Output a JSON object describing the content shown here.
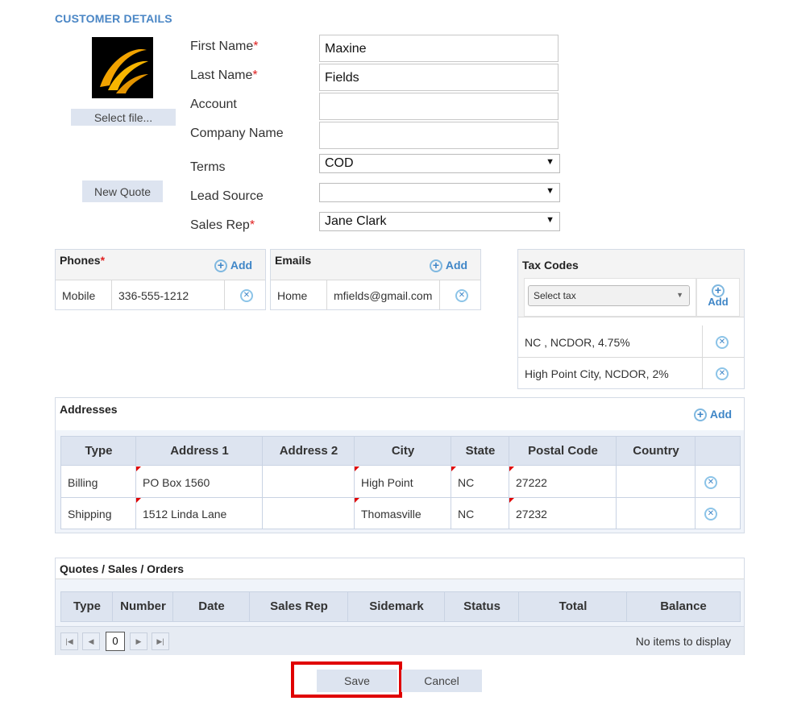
{
  "header": {
    "title": "CUSTOMER DETAILS"
  },
  "photo": {
    "select_file_label": "Select file..."
  },
  "new_quote_label": "New Quote",
  "form": {
    "first_name": {
      "label": "First Name",
      "value": "Maxine"
    },
    "last_name": {
      "label": "Last Name",
      "value": "Fields"
    },
    "account": {
      "label": "Account",
      "value": ""
    },
    "company_name": {
      "label": "Company Name",
      "value": ""
    },
    "terms": {
      "label": "Terms",
      "value": "COD"
    },
    "lead_source": {
      "label": "Lead Source",
      "value": ""
    },
    "sales_rep": {
      "label": "Sales Rep",
      "value": "Jane Clark"
    },
    "required_mark": "*"
  },
  "phones": {
    "title": "Phones",
    "add_label": "Add",
    "rows": [
      {
        "type": "Mobile",
        "value": "336-555-1212"
      }
    ]
  },
  "emails": {
    "title": "Emails",
    "add_label": "Add",
    "rows": [
      {
        "type": "Home",
        "value": "mfields@gmail.com"
      }
    ]
  },
  "tax_codes": {
    "title": "Tax Codes",
    "select_placeholder": "Select tax",
    "add_label": "Add",
    "rows": [
      "NC , NCDOR, 4.75%",
      "High Point City, NCDOR, 2%"
    ]
  },
  "addresses": {
    "title": "Addresses",
    "add_label": "Add",
    "columns": [
      "Type",
      "Address 1",
      "Address 2",
      "City",
      "State",
      "Postal Code",
      "Country"
    ],
    "rows": [
      {
        "type": "Billing",
        "address1": "PO Box 1560",
        "address2": "",
        "city": "High Point",
        "state": "NC",
        "postal": "27222",
        "country": ""
      },
      {
        "type": "Shipping",
        "address1": "1512 Linda Lane",
        "address2": "",
        "city": "Thomasville",
        "state": "NC",
        "postal": "27232",
        "country": ""
      }
    ]
  },
  "orders": {
    "title": "Quotes / Sales / Orders",
    "columns": [
      "Type",
      "Number",
      "Date",
      "Sales Rep",
      "Sidemark",
      "Status",
      "Total",
      "Balance"
    ],
    "page": "0",
    "empty_text": "No items to display"
  },
  "footer": {
    "save_label": "Save",
    "cancel_label": "Cancel"
  },
  "colors": {
    "accent": "#4a86c5",
    "required": "#e02020",
    "highlight": "#e00000",
    "header_bg": "#dde4f0"
  },
  "icons": {
    "logo": "gold-swirl-logo",
    "add": "plus-circle-icon",
    "remove": "x-circle-icon"
  }
}
